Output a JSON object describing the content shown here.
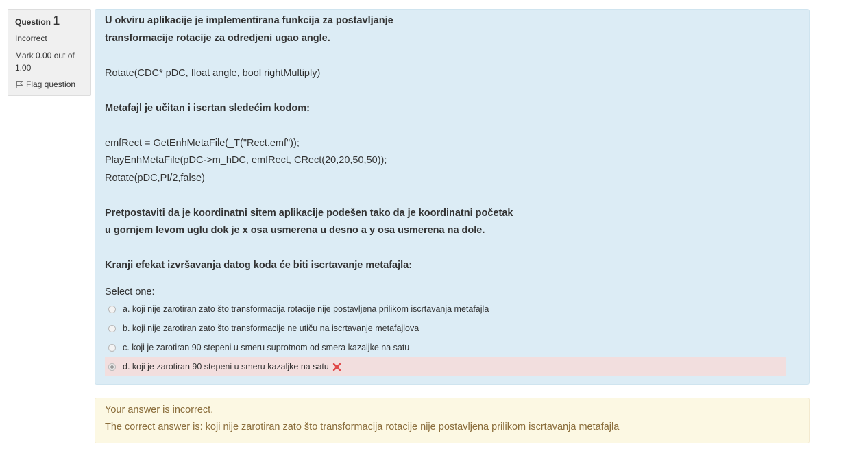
{
  "info": {
    "question_label": "Question",
    "question_number": "1",
    "state": "Incorrect",
    "grade_line1": "Mark 0.00 out of",
    "grade_line2": "1.00",
    "flag_label": "Flag question",
    "flag_icon": "flag-icon"
  },
  "question": {
    "lines": [
      "U okviru aplikacije je implementirana funkcija za postavljanje",
      "transformacije rotacije za odredjeni ugao angle.",
      "Rotate(CDC* pDC, float angle, bool rightMultiply)",
      "Metafajl je učitan i iscrtan sledećim kodom:",
      "emfRect = GetEnhMetaFile(_T(\"Rect.emf\"));",
      "PlayEnhMetaFile(pDC->m_hDC, emfRect, CRect(20,20,50,50));",
      "Rotate(pDC,PI/2,false)",
      "Pretpostaviti da je koordinatni sitem aplikacije podešen tako da je koordinatni početak",
      "u gornjem levom uglu dok je x osa usmerena u desno a y osa usmerena na dole.",
      "Kranji efekat izvršavanja datog koda će biti iscrtavanje metafajla:"
    ],
    "prompt": "Select one:",
    "options": [
      {
        "label": "a. koji nije zarotiran zato što transformacija rotacije nije postavljena prilikom iscrtavanja metafajla",
        "checked": false,
        "incorrect": false
      },
      {
        "label": "b. koji nije zarotiran zato što transformacije ne utiču na iscrtavanje metafajlova",
        "checked": false,
        "incorrect": false
      },
      {
        "label": "c. koji je zarotiran 90 stepeni u smeru suprotnom od smera kazaljke na satu",
        "checked": false,
        "incorrect": false
      },
      {
        "label": "d. koji je zarotiran 90 stepeni u smeru kazaljke na satu",
        "checked": true,
        "incorrect": true,
        "icon": "incorrect-x-icon"
      }
    ]
  },
  "feedback": {
    "line1": "Your answer is incorrect.",
    "line2": "The correct answer is: koji nije zarotiran zato što transformacija rotacije nije postavljena prilikom iscrtavanja metafajla"
  },
  "colors": {
    "question_bg": "#dcecf5",
    "incorrect_bg": "#f2dede",
    "feedback_bg": "#fcf8e3",
    "feedback_text": "#8a6d3b",
    "x_mark": "#e04848"
  }
}
